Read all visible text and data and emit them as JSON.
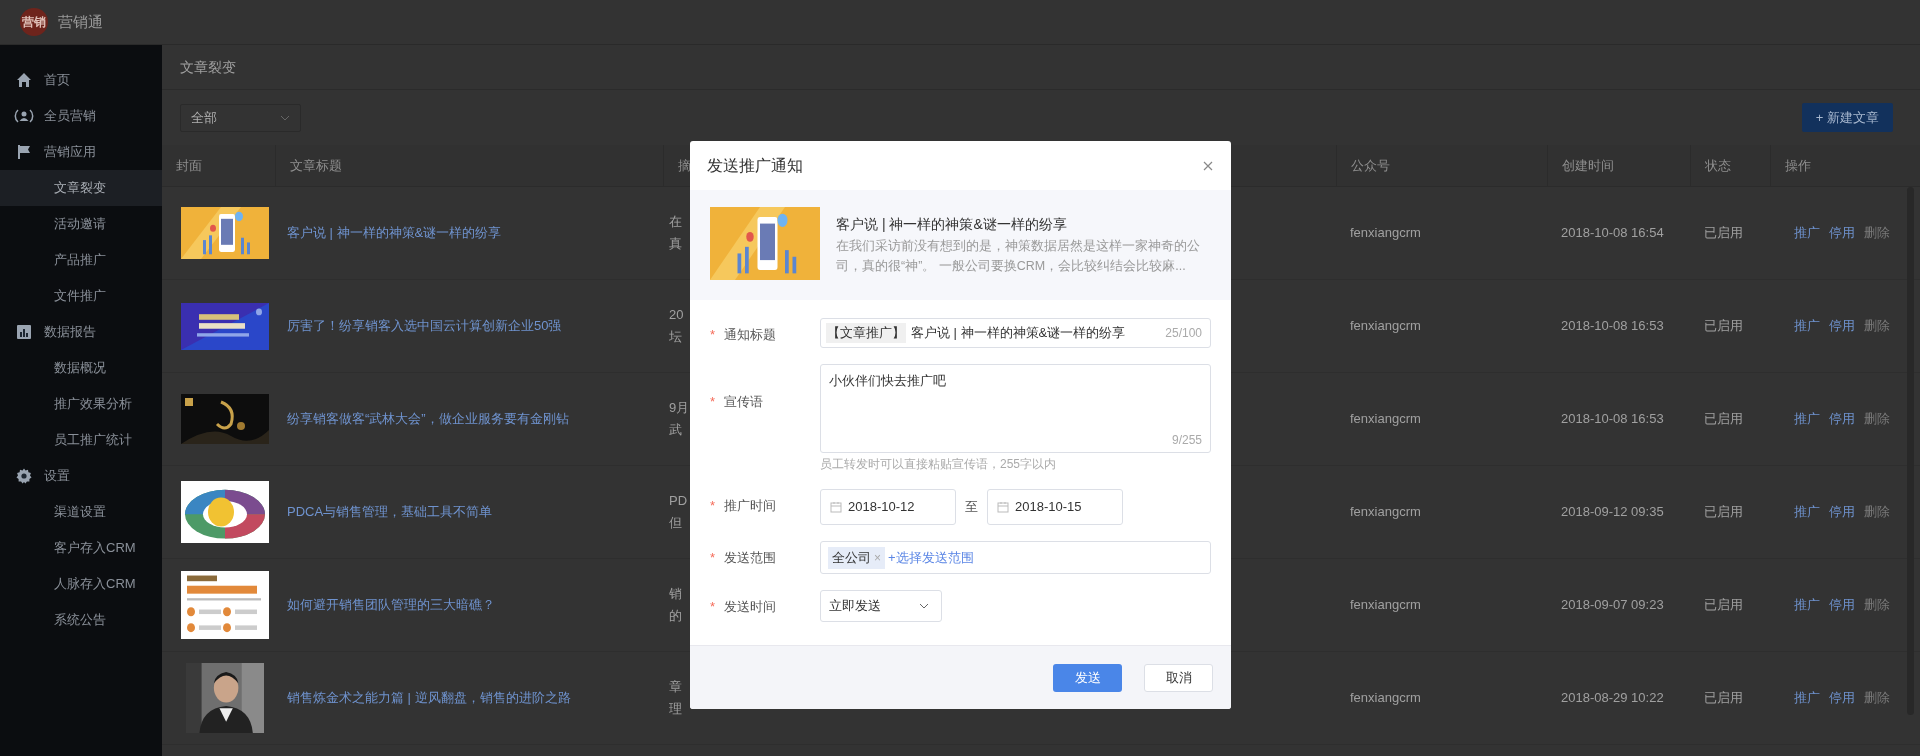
{
  "app": {
    "logo_text": "营销",
    "name": "营销通"
  },
  "sidebar": {
    "items": [
      {
        "label": "首页",
        "selected": false
      },
      {
        "label": "全员营销",
        "selected": false
      },
      {
        "label": "营销应用",
        "selected": false,
        "children": [
          {
            "label": "文章裂变",
            "selected": true
          },
          {
            "label": "活动邀请",
            "selected": false
          },
          {
            "label": "产品推广",
            "selected": false
          },
          {
            "label": "文件推广",
            "selected": false
          }
        ]
      },
      {
        "label": "数据报告",
        "selected": false,
        "children": [
          {
            "label": "数据概况",
            "selected": false
          },
          {
            "label": "推广效果分析",
            "selected": false
          },
          {
            "label": "员工推广统计",
            "selected": false
          }
        ]
      },
      {
        "label": "设置",
        "selected": false,
        "children": [
          {
            "label": "渠道设置",
            "selected": false
          },
          {
            "label": "客户存入CRM",
            "selected": false
          },
          {
            "label": "人脉存入CRM",
            "selected": false
          },
          {
            "label": "系统公告",
            "selected": false
          }
        ]
      }
    ]
  },
  "breadcrumb": "文章裂变",
  "filter": {
    "value": "全部"
  },
  "new_button": "+ 新建文章",
  "table": {
    "columns": [
      "封面",
      "文章标题",
      "摘",
      "公众号",
      "创建时间",
      "状态",
      "操作"
    ],
    "rows": [
      {
        "cover": {
          "kind": "picture"
        },
        "title": "客户说 | 神一样的神策&谜一样的纷享",
        "summary": [
          "在",
          "真"
        ],
        "account": "fenxiangcrm",
        "created": "2018-10-08 16:54",
        "status": "已启用",
        "actions": [
          {
            "label": "推广",
            "disabled": false
          },
          {
            "label": "停用",
            "disabled": false
          },
          {
            "label": "删除",
            "disabled": true
          }
        ]
      },
      {
        "cover": {
          "kind": "picture"
        },
        "title": "厉害了！纷享销客入选中国云计算创新企业50强",
        "summary": [
          "20",
          "坛"
        ],
        "account": "fenxiangcrm",
        "created": "2018-10-08 16:53",
        "status": "已启用",
        "actions": [
          {
            "label": "推广",
            "disabled": false
          },
          {
            "label": "停用",
            "disabled": false
          },
          {
            "label": "删除",
            "disabled": true
          }
        ]
      },
      {
        "cover": {
          "kind": "picture"
        },
        "title": "纷享销客做客“武林大会”，做企业服务要有金刚钻",
        "summary": [
          "9月",
          "武"
        ],
        "account": "fenxiangcrm",
        "created": "2018-10-08 16:53",
        "status": "已启用",
        "actions": [
          {
            "label": "推广",
            "disabled": false
          },
          {
            "label": "停用",
            "disabled": false
          },
          {
            "label": "删除",
            "disabled": true
          }
        ]
      },
      {
        "cover": {
          "kind": "picture"
        },
        "title": "PDCA与销售管理，基础工具不简单",
        "summary": [
          "PD",
          "但"
        ],
        "account": "fenxiangcrm",
        "created": "2018-09-12 09:35",
        "status": "已启用",
        "actions": [
          {
            "label": "推广",
            "disabled": false
          },
          {
            "label": "停用",
            "disabled": false
          },
          {
            "label": "删除",
            "disabled": true
          }
        ]
      },
      {
        "cover": {
          "kind": "picture"
        },
        "title": "如何避开销售团队管理的三大暗礁？",
        "summary": [
          "销",
          "的"
        ],
        "account": "fenxiangcrm",
        "created": "2018-09-07 09:23",
        "status": "已启用",
        "actions": [
          {
            "label": "推广",
            "disabled": false
          },
          {
            "label": "停用",
            "disabled": false
          },
          {
            "label": "删除",
            "disabled": true
          }
        ]
      },
      {
        "cover": {
          "kind": "picture"
        },
        "title": "销售炼金术之能力篇 | 逆风翻盘，销售的进阶之路",
        "summary": [
          "章",
          "理"
        ],
        "account": "fenxiangcrm",
        "created": "2018-08-29 10:22",
        "status": "已启用",
        "actions": [
          {
            "label": "推广",
            "disabled": false
          },
          {
            "label": "停用",
            "disabled": false
          },
          {
            "label": "删除",
            "disabled": true
          }
        ]
      }
    ]
  },
  "modal": {
    "title": "发送推广通知",
    "preview": {
      "title": "客户说 | 神一样的神策&谜一样的纷享",
      "description": "在我们采访前没有想到的是，神策数据居然是这样一家神奇的公司，真的很“神”。 一般公司要换CRM，会比较纠结会比较麻..."
    },
    "fields": [
      {
        "kind": "text",
        "marker": "*",
        "label": "通知标题",
        "prefix": "【文章推广】",
        "value": "客户说 | 神一样的神策&谜一样的纷享",
        "count": "25/100"
      },
      {
        "kind": "textarea",
        "marker": "*",
        "label": "宣传语",
        "value": "小伙伴们快去推广吧",
        "count": "9/255",
        "hint": "员工转发时可以直接粘贴宣传语，255字以内"
      },
      {
        "kind": "daterange",
        "marker": "*",
        "label": "推广时间",
        "start": "2018-10-12",
        "separator": "至",
        "end": "2018-10-15"
      },
      {
        "kind": "tags",
        "marker": "*",
        "label": "发送范围",
        "tags": [
          {
            "label": "全公司",
            "remove": "×"
          }
        ],
        "link": "+选择发送范围"
      },
      {
        "kind": "select",
        "marker": "*",
        "label": "发送时间",
        "value": "立即发送"
      }
    ],
    "buttons": [
      {
        "label": "发送",
        "primary": true
      },
      {
        "label": "取消",
        "primary": false
      }
    ]
  }
}
